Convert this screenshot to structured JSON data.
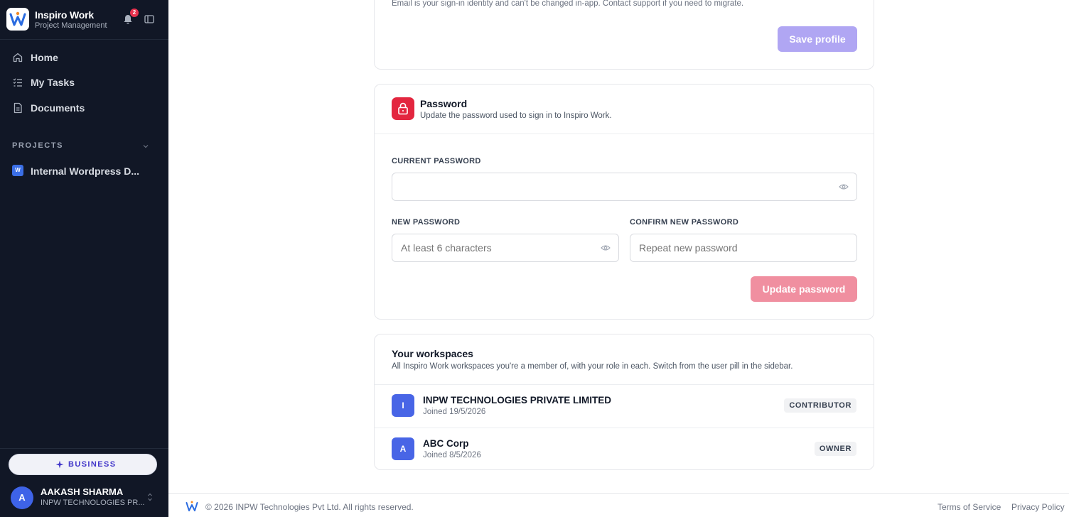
{
  "brand": {
    "title": "Inspiro Work",
    "subtitle": "Project Management",
    "notification_count": "2"
  },
  "nav": {
    "items": [
      {
        "label": "Home",
        "icon": "home-icon"
      },
      {
        "label": "My Tasks",
        "icon": "tasks-icon"
      },
      {
        "label": "Documents",
        "icon": "document-icon"
      }
    ]
  },
  "projects": {
    "heading": "PROJECTS",
    "items": [
      {
        "badge": "W",
        "label": "Internal Wordpress D..."
      }
    ]
  },
  "plan": {
    "label": "BUSINESS"
  },
  "user": {
    "initial": "A",
    "name": "AAKASH SHARMA",
    "org": "INPW TECHNOLOGIES PR..."
  },
  "profile": {
    "email_note": "Email is your sign-in identity and can't be changed in-app. Contact support if you need to migrate.",
    "save_label": "Save profile"
  },
  "password": {
    "title": "Password",
    "subtitle": "Update the password used to sign in to Inspiro Work.",
    "current_label": "CURRENT PASSWORD",
    "current_placeholder": "",
    "new_label": "NEW PASSWORD",
    "new_placeholder": "At least 6 characters",
    "confirm_label": "CONFIRM NEW PASSWORD",
    "confirm_placeholder": "Repeat new password",
    "update_label": "Update password"
  },
  "workspaces": {
    "title": "Your workspaces",
    "subtitle": "All Inspiro Work workspaces you're a member of, with your role in each. Switch from the user pill in the sidebar.",
    "items": [
      {
        "initial": "I",
        "name": "INPW TECHNOLOGIES PRIVATE LIMITED",
        "joined": "Joined 19/5/2026",
        "role": "CONTRIBUTOR"
      },
      {
        "initial": "A",
        "name": "ABC Corp",
        "joined": "Joined 8/5/2026",
        "role": "OWNER"
      }
    ]
  },
  "footer": {
    "copyright": "© 2026 INPW Technologies Pvt Ltd. All rights reserved.",
    "terms": "Terms of Service",
    "privacy": "Privacy Policy"
  },
  "colors": {
    "sidebar_bg": "#111726",
    "accent_purple": "#b0a6f3",
    "accent_red": "#e3263f",
    "update_btn": "#f08fa0",
    "workspace_avatar": "#4865e6"
  }
}
